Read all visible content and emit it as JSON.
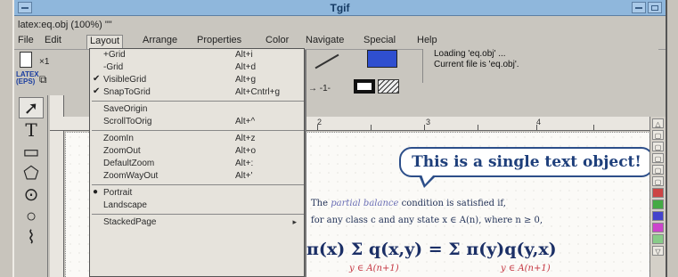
{
  "window": {
    "title": "Tgif",
    "file_line": "latex:eq.obj (100%) \"\""
  },
  "menubar": [
    "File",
    "Edit",
    "Layout",
    "Arrange",
    "Properties",
    "Color",
    "Navigate",
    "Special",
    "Help"
  ],
  "toolbar": {
    "mode_label": "LATEX (EPS)"
  },
  "status": [
    "Loading 'eq.obj' ...",
    "Current file is 'eq.obj'."
  ],
  "layout_menu": {
    "items": [
      {
        "label": "+Grid",
        "accel": "Alt+i",
        "check": ""
      },
      {
        "label": "-Grid",
        "accel": "Alt+d",
        "check": ""
      },
      {
        "label": "VisibleGrid",
        "accel": "Alt+g",
        "check": "✔"
      },
      {
        "label": "SnapToGrid",
        "accel": "Alt+Cntrl+g",
        "check": "✔"
      },
      {
        "label": "SaveOrigin",
        "accel": "",
        "check": ""
      },
      {
        "label": "ScrollToOrig",
        "accel": "Alt+^",
        "check": ""
      },
      {
        "label": "ZoomIn",
        "accel": "Alt+z",
        "check": ""
      },
      {
        "label": "ZoomOut",
        "accel": "Alt+o",
        "check": ""
      },
      {
        "label": "DefaultZoom",
        "accel": "Alt+:",
        "check": ""
      },
      {
        "label": "ZoomWayOut",
        "accel": "Alt+'",
        "check": ""
      },
      {
        "label": "Portrait",
        "accel": "",
        "check": "●"
      },
      {
        "label": "Landscape",
        "accel": "",
        "check": ""
      },
      {
        "label": "StackedPage",
        "accel": "",
        "check": "",
        "submenu": "▸"
      }
    ]
  },
  "ruler": {
    "numbers": [
      "1",
      "2",
      "3",
      "4"
    ]
  },
  "canvas": {
    "bubble_text": "This is a single text object!",
    "para_line1_pre": "The",
    "para_line1_em": "partial balance",
    "para_line1_post": "condition is satisfied if,",
    "para_line2": "for any class c and any state x ∈ A(n), where n ≥ 0,",
    "equation": "π(x)  Σ  q(x,y)  =  Σ  π(y)q(y,x)",
    "sum_sub_left": "y ∈ A(n+1)",
    "sum_sub_right": "y ∈ A(n+1)"
  }
}
